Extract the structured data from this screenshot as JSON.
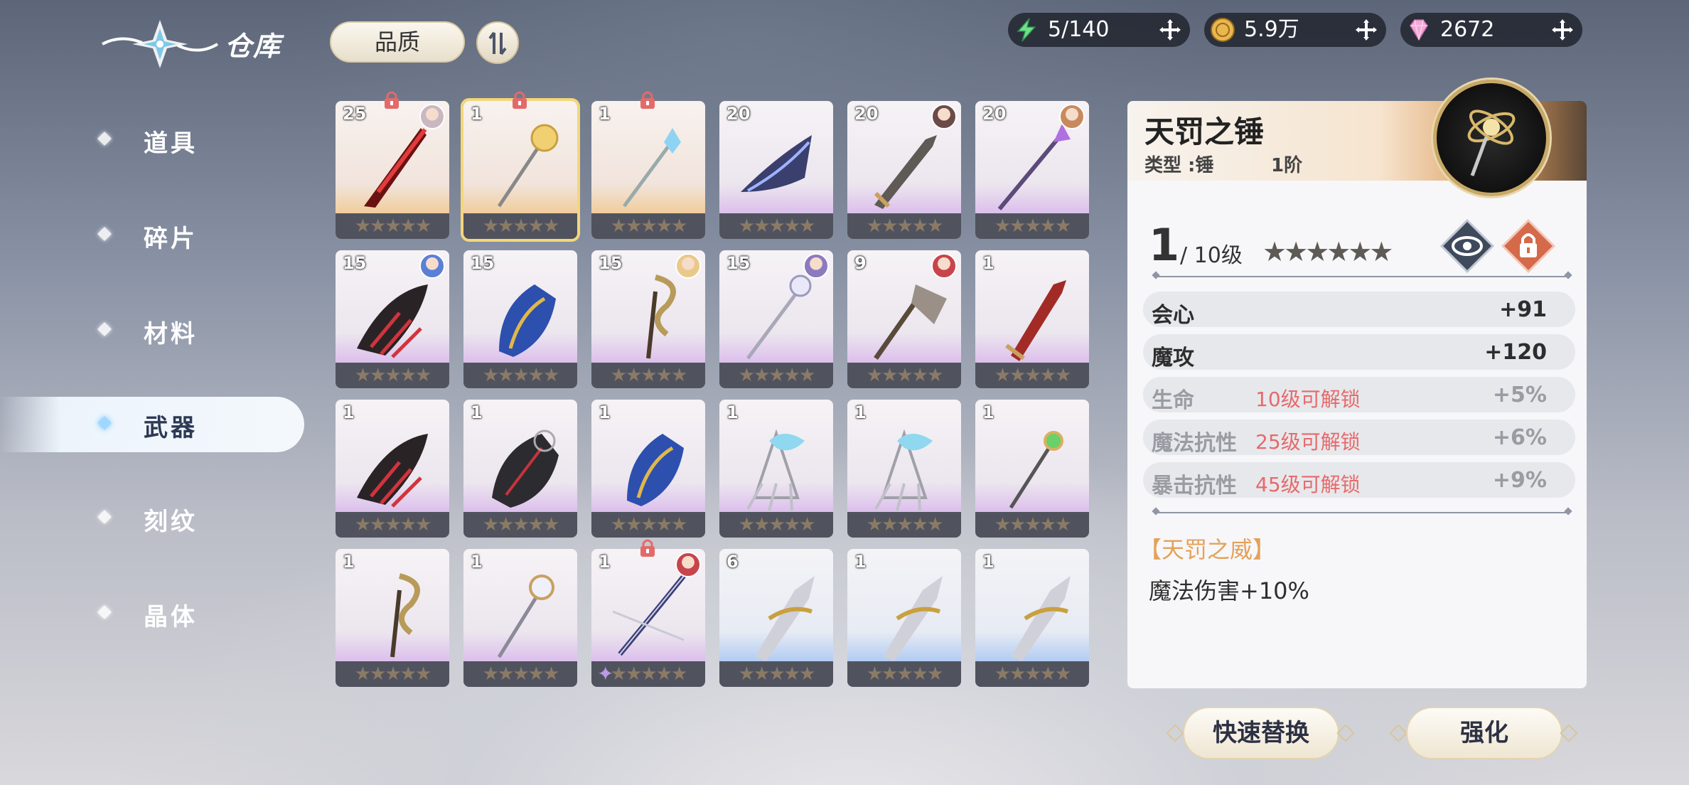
{
  "header": {
    "title": "仓库",
    "sort_label": "品质",
    "order_icon": "sort-order-icon",
    "resources": [
      {
        "name": "stamina",
        "icon": "lightning-icon",
        "value": "5/140"
      },
      {
        "name": "coins",
        "icon": "coin-icon",
        "value": "5.9万"
      },
      {
        "name": "gems",
        "icon": "diamond-icon",
        "value": "2672"
      }
    ]
  },
  "sidebar": {
    "items": [
      {
        "label": "道具"
      },
      {
        "label": "碎片"
      },
      {
        "label": "材料"
      },
      {
        "label": "武器",
        "active": true
      },
      {
        "label": "刻纹"
      },
      {
        "label": "晶体"
      }
    ]
  },
  "grid": {
    "items": [
      {
        "count": "25",
        "rarity": "gold",
        "locked": true,
        "avatar": "#c9b8c2",
        "weapon": "red-blade"
      },
      {
        "count": "1",
        "rarity": "gold",
        "locked": true,
        "selected": true,
        "weapon": "star-staff"
      },
      {
        "count": "1",
        "rarity": "gold",
        "locked": true,
        "weapon": "ice-staff"
      },
      {
        "count": "20",
        "rarity": "purple",
        "avatar": null,
        "weapon": "dark-axe"
      },
      {
        "count": "20",
        "rarity": "purple",
        "avatar": "#6b4a48",
        "weapon": "broadsword"
      },
      {
        "count": "20",
        "rarity": "purple",
        "avatar": "#c78a5f",
        "weapon": "violet-spear"
      },
      {
        "count": "15",
        "rarity": "purple",
        "avatar": "#5b7fd6",
        "weapon": "red-claw"
      },
      {
        "count": "15",
        "rarity": "purple",
        "avatar": null,
        "weapon": "blue-gauntlet"
      },
      {
        "count": "15",
        "rarity": "purple",
        "avatar": "#e9c98a",
        "weapon": "serpent-staff"
      },
      {
        "count": "15",
        "rarity": "purple",
        "avatar": "#8c7ac0",
        "weapon": "moon-staff"
      },
      {
        "count": "9",
        "rarity": "purple",
        "avatar": "#c8444c",
        "weapon": "war-axe"
      },
      {
        "count": "1",
        "rarity": "purple",
        "avatar": null,
        "weapon": "dagger"
      },
      {
        "count": "1",
        "rarity": "purple",
        "weapon": "red-claw"
      },
      {
        "count": "1",
        "rarity": "purple",
        "weapon": "black-gauntlet"
      },
      {
        "count": "1",
        "rarity": "purple",
        "weapon": "blue-gauntlet"
      },
      {
        "count": "1",
        "rarity": "purple",
        "weapon": "ice-claw"
      },
      {
        "count": "1",
        "rarity": "purple",
        "weapon": "ice-claw"
      },
      {
        "count": "1",
        "rarity": "purple",
        "weapon": "emerald-staff"
      },
      {
        "count": "1",
        "rarity": "purple",
        "weapon": "serpent-staff"
      },
      {
        "count": "1",
        "rarity": "purple",
        "weapon": "sun-staff"
      },
      {
        "count": "1",
        "rarity": "purple",
        "locked": true,
        "avatar": "#c8444c",
        "weapon": "bow",
        "spark": true
      },
      {
        "count": "6",
        "rarity": "blue",
        "weapon": "gold-sword"
      },
      {
        "count": "1",
        "rarity": "blue",
        "weapon": "gold-sword"
      },
      {
        "count": "1",
        "rarity": "blue",
        "weapon": "gold-sword"
      }
    ],
    "stars_text": "★★★★★"
  },
  "detail": {
    "name": "天罚之锤",
    "type": "类型 :锤",
    "stage": "1阶",
    "level": "1",
    "max_level": "/ 10级",
    "stars_text": "★★★★★★",
    "stats": [
      {
        "name": "会心",
        "value": "+91",
        "lock_text": ""
      },
      {
        "name": "魔攻",
        "value": "+120",
        "lock_text": ""
      },
      {
        "name": "生命",
        "value": "+5%",
        "lock_text": "10级可解锁"
      },
      {
        "name": "魔法抗性",
        "value": "+6%",
        "lock_text": "25级可解锁"
      },
      {
        "name": "暴击抗性",
        "value": "+9%",
        "lock_text": "45级可解锁"
      }
    ],
    "skill_name": "【天罚之威】",
    "skill_desc": "魔法伤害+10%"
  },
  "actions": {
    "quick_replace": "快速替换",
    "enhance": "强化"
  },
  "colors": {
    "accent_gold": "#c8a867",
    "lock_red": "#e66a6a",
    "skill_orange": "#e3a25a"
  }
}
